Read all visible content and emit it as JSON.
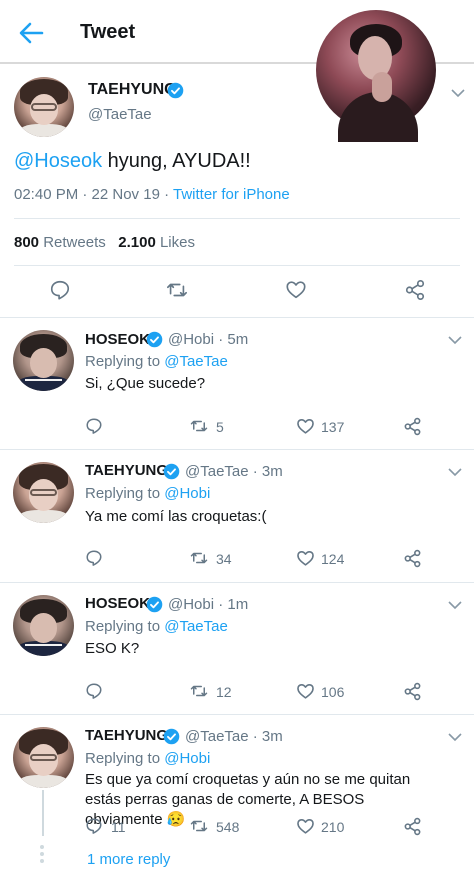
{
  "header": {
    "title": "Tweet"
  },
  "main_tweet": {
    "name": "TAEHYUNG",
    "handle": "@TaeTae",
    "mention": "@Hoseok",
    "text": " hyung, AYUDA!!",
    "timestamp": "02:40 PM · 22 Nov 19 · ",
    "source": "Twitter for iPhone",
    "retweets_count": "800",
    "retweets_label": "Retweets",
    "likes_count": "2.100",
    "likes_label": "Likes"
  },
  "replies": [
    {
      "name": "HOSEOK",
      "handle_time": "@Hobi · 5m",
      "replying_prefix": "Replying to ",
      "replying_to": "@TaeTae",
      "text": "Si, ¿Que sucede?",
      "replies": "",
      "retweets": "5",
      "likes": "137"
    },
    {
      "name": "TAEHYUNG",
      "handle_time": "@TaeTae · 3m",
      "replying_prefix": "Replying to ",
      "replying_to": "@Hobi",
      "text": "Ya me comí las croquetas:(",
      "replies": "",
      "retweets": "34",
      "likes": "124"
    },
    {
      "name": "HOSEOK",
      "handle_time": "@Hobi · 1m",
      "replying_prefix": "Replying to ",
      "replying_to": "@TaeTae",
      "text": "ESO K?",
      "replies": "",
      "retweets": "12",
      "likes": "106"
    },
    {
      "name": "TAEHYUNG",
      "handle_time": "@TaeTae · 3m",
      "replying_prefix": "Replying to ",
      "replying_to": "@Hobi",
      "text": "Es que ya comí croquetas y aún no se me quitan estás perras ganas de comerte, A BESOS obviamente 😥",
      "replies": "11",
      "retweets": "548",
      "likes": "210"
    }
  ],
  "more_replies_label": "1 more reply",
  "colors": {
    "accent": "#1da1f2",
    "muted": "#657786",
    "text": "#14171a",
    "divider": "#e1e8ed"
  }
}
